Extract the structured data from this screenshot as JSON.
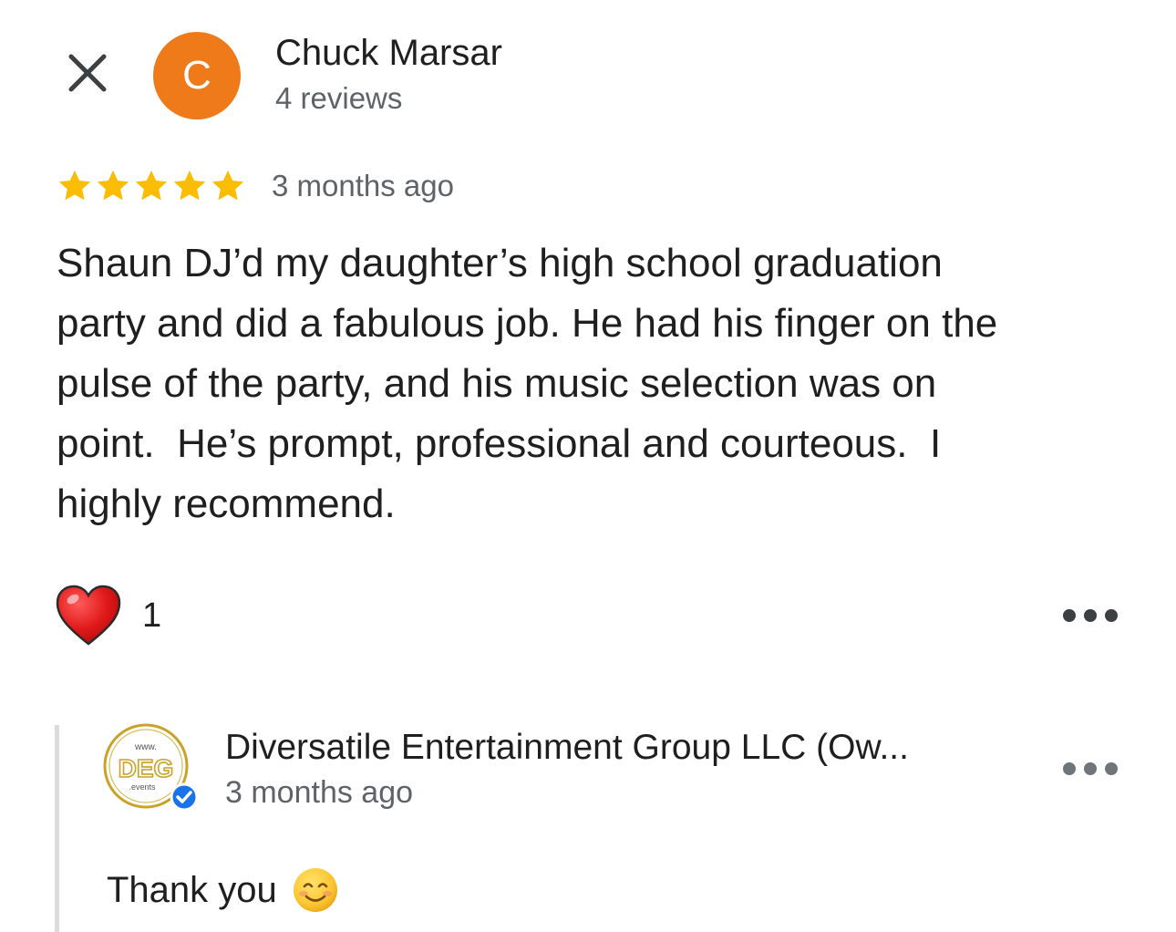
{
  "header": {
    "close_icon": "close-icon",
    "avatar_letter": "C",
    "avatar_color": "#ef7a1a",
    "reviewer_name": "Chuck Marsar",
    "reviewer_reviews": "4 reviews"
  },
  "review": {
    "rating": 5,
    "rating_max": 5,
    "star_color": "#fbbc04",
    "time": "3 months ago",
    "text": "Shaun DJ’d my daughter’s high school graduation\nparty and did a fabulous job. He had his finger on the\npulse of the party, and his music selection was on\npoint.  He’s prompt, professional and courteous.  I\nhighly recommend.",
    "reaction_icon": "heart-icon",
    "reaction_count": "1",
    "more_icon": "more-options-icon"
  },
  "owner_reply": {
    "logo_text_top": "www.",
    "logo_text_main": "DEG",
    "logo_text_bottom": ".events",
    "logo_color": "#c9a227",
    "verified_icon": "verified-badge-icon",
    "verified_color": "#1a73e8",
    "name": "Diversatile Entertainment Group LLC (Ow...",
    "time": "3 months ago",
    "text": "Thank you",
    "emoji_icon": "smiling-face-icon",
    "more_icon": "more-options-icon"
  }
}
